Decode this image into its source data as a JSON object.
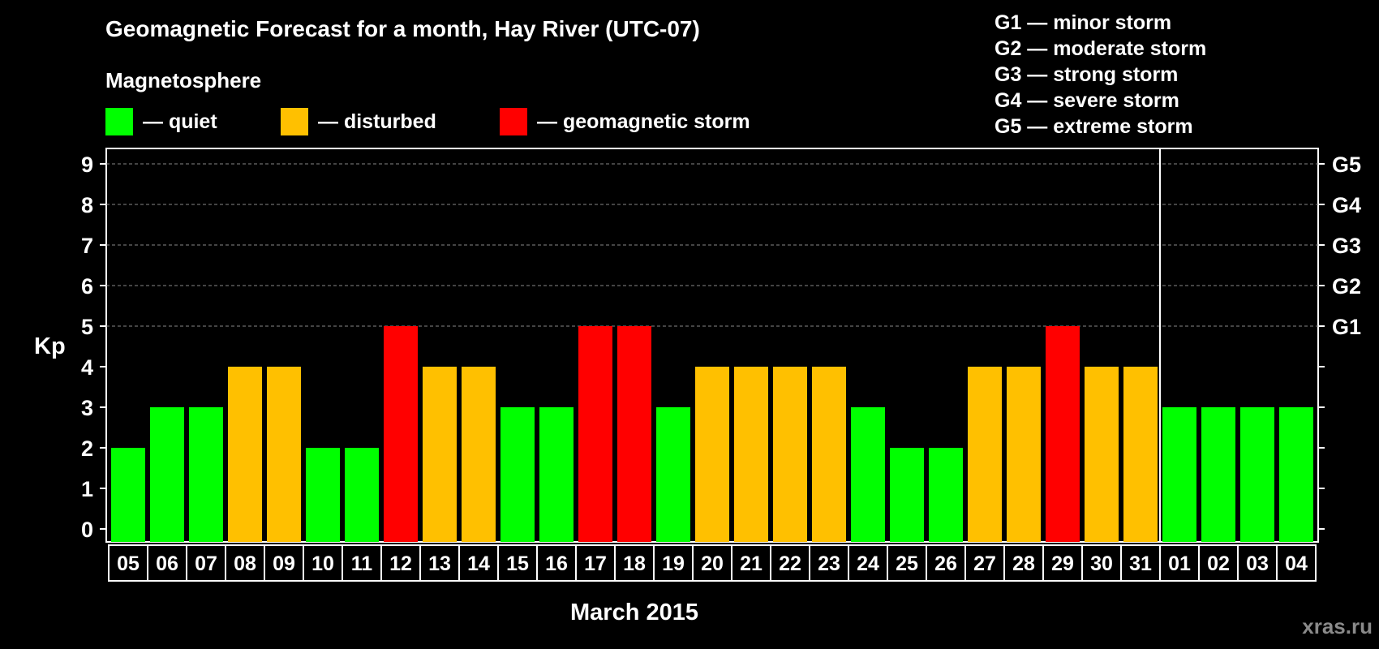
{
  "header": {
    "title": "Geomagnetic Forecast for a month, Hay River (UTC-07)",
    "subtitle": "Magnetosphere"
  },
  "legend": [
    {
      "label": "— quiet",
      "color": "#00ff00"
    },
    {
      "label": "— disturbed",
      "color": "#ffc000"
    },
    {
      "label": "— geomagnetic storm",
      "color": "#ff0000"
    }
  ],
  "storm_levels": [
    "G1 — minor storm",
    "G2 — moderate storm",
    "G3 — strong storm",
    "G4 — severe storm",
    "G5 — extreme storm"
  ],
  "watermark": "xras.ru",
  "chart_data": {
    "type": "bar",
    "title": "Geomagnetic Forecast for a month, Hay River (UTC-07)",
    "xlabel": "March 2015",
    "ylabel": "Kp",
    "ylim": [
      0,
      9
    ],
    "yticks": [
      0,
      1,
      2,
      3,
      4,
      5,
      6,
      7,
      8,
      9
    ],
    "grid": "dashed at Kp 5–9",
    "right_axis_labels": [
      {
        "kp": 5,
        "label": "G1"
      },
      {
        "kp": 6,
        "label": "G2"
      },
      {
        "kp": 7,
        "label": "G3"
      },
      {
        "kp": 8,
        "label": "G4"
      },
      {
        "kp": 9,
        "label": "G5"
      }
    ],
    "month_divider_after": "31",
    "categories": [
      "05",
      "06",
      "07",
      "08",
      "09",
      "10",
      "11",
      "12",
      "13",
      "14",
      "15",
      "16",
      "17",
      "18",
      "19",
      "20",
      "21",
      "22",
      "23",
      "24",
      "25",
      "26",
      "27",
      "28",
      "29",
      "30",
      "31",
      "01",
      "02",
      "03",
      "04"
    ],
    "values": [
      2,
      3,
      3,
      4,
      4,
      2,
      2,
      5,
      4,
      4,
      3,
      3,
      5,
      5,
      3,
      4,
      4,
      4,
      4,
      3,
      2,
      2,
      4,
      4,
      5,
      4,
      4,
      3,
      3,
      3,
      3
    ],
    "colors": {
      "quiet": "#00ff00",
      "disturbed": "#ffc000",
      "storm": "#ff0000"
    },
    "thresholds": {
      "disturbed_from": 4,
      "storm_from": 5
    }
  }
}
